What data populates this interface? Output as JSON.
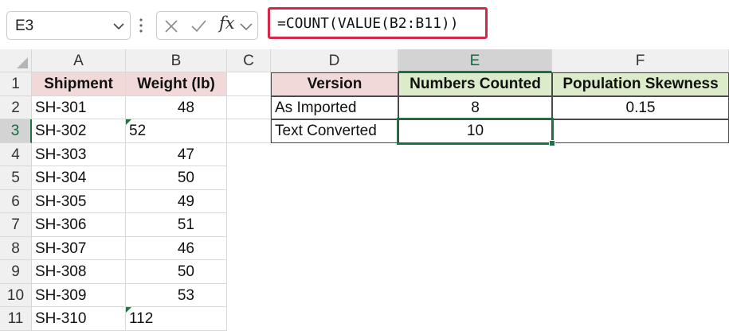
{
  "name_box": {
    "value": "E3"
  },
  "formula_bar": {
    "fx_label": "fx",
    "formula": "=COUNT(VALUE(B2:B11))"
  },
  "columns": [
    "A",
    "B",
    "C",
    "D",
    "E",
    "F"
  ],
  "rows": [
    "1",
    "2",
    "3",
    "4",
    "5",
    "6",
    "7",
    "8",
    "9",
    "10",
    "11"
  ],
  "table_left": {
    "headers": [
      "Shipment",
      "Weight (lb)"
    ],
    "rows": [
      {
        "shipment": "SH-301",
        "weight": "48"
      },
      {
        "shipment": "SH-302",
        "weight": "52"
      },
      {
        "shipment": "SH-303",
        "weight": "47"
      },
      {
        "shipment": "SH-304",
        "weight": "50"
      },
      {
        "shipment": "SH-305",
        "weight": "49"
      },
      {
        "shipment": "SH-306",
        "weight": "51"
      },
      {
        "shipment": "SH-307",
        "weight": "46"
      },
      {
        "shipment": "SH-308",
        "weight": "50"
      },
      {
        "shipment": "SH-309",
        "weight": "53"
      },
      {
        "shipment": "SH-310",
        "weight": "112"
      }
    ]
  },
  "table_right": {
    "headers": [
      "Version",
      "Numbers Counted",
      "Population Skewness"
    ],
    "rows": [
      {
        "version": "As Imported",
        "count": "8",
        "skew": "0.15"
      },
      {
        "version": "Text Converted",
        "count": "10",
        "skew": ""
      }
    ]
  },
  "colors": {
    "accent": "#217346",
    "highlight_border": "#d4274a",
    "header_pink": "#f2d9d9",
    "header_green": "#dcebc9"
  }
}
